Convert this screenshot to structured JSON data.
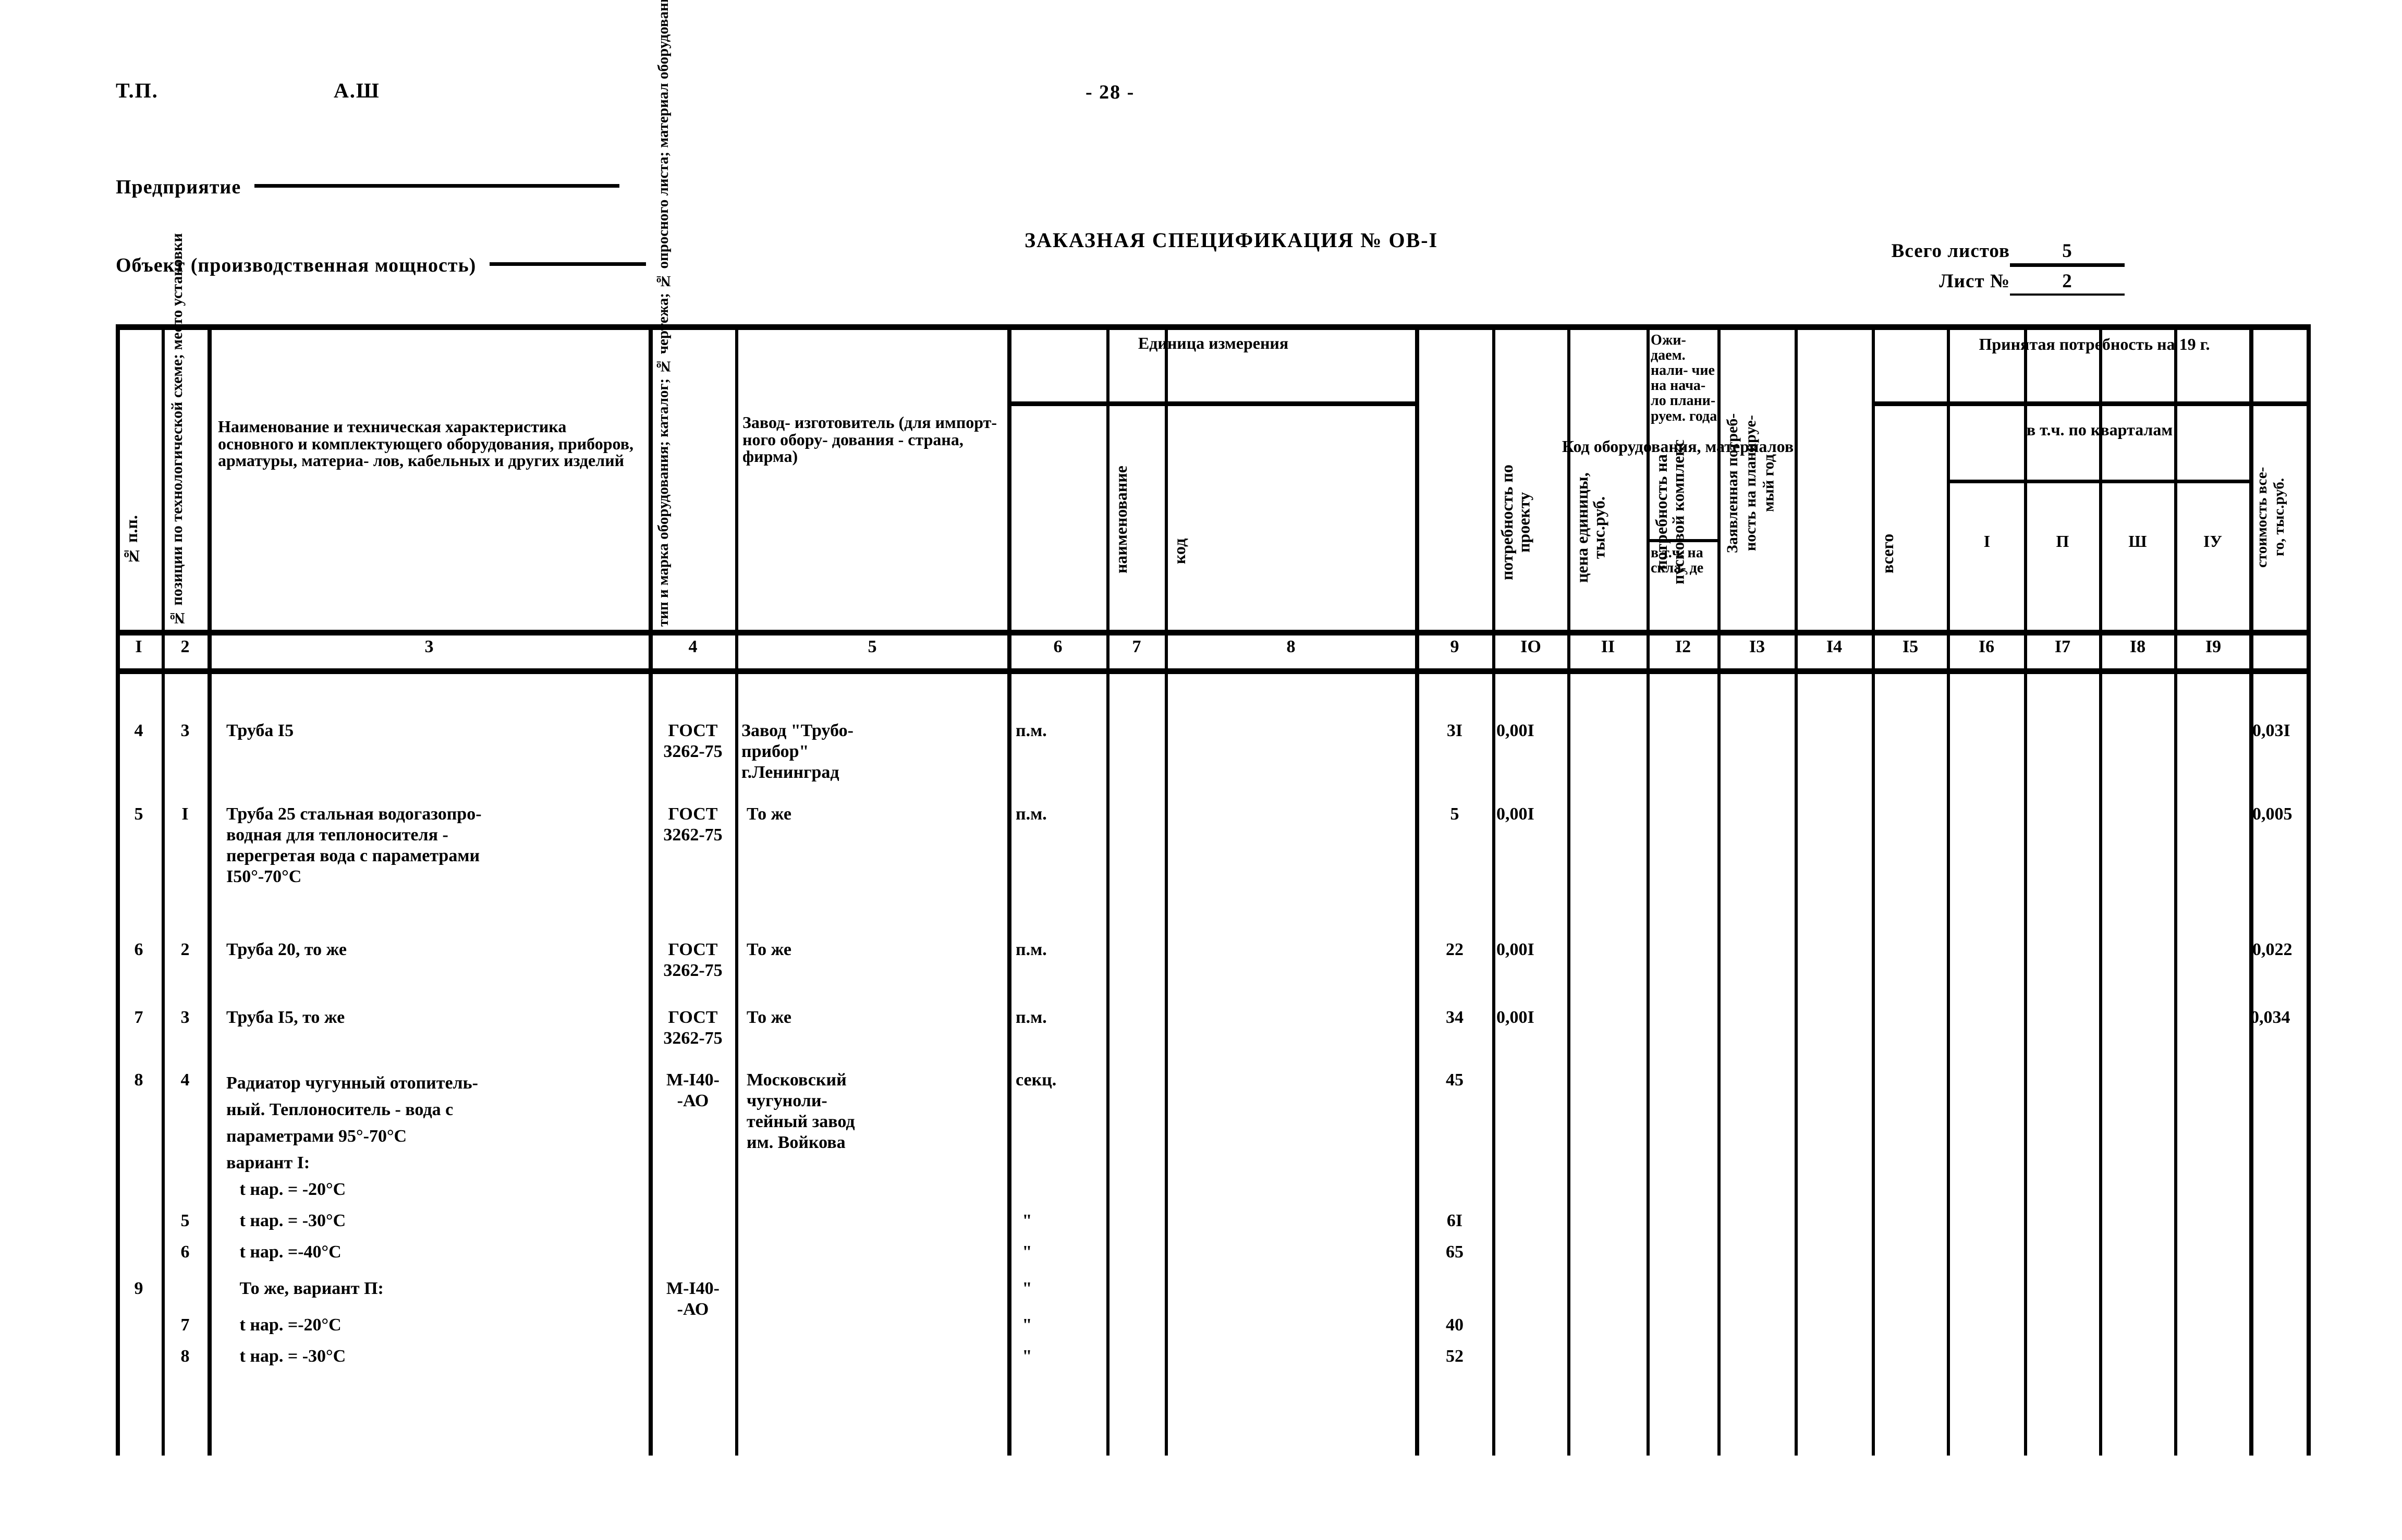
{
  "header": {
    "doc_code": "Т.П.",
    "doc_section": "А.Ш",
    "page_number": "- 28 -",
    "enterprise_label": "Предприятие",
    "object_label": "Объект (производственная мощность)",
    "spec_title": "ЗАКАЗНАЯ СПЕЦИФИКАЦИЯ № ОВ-I",
    "sheets_total_label": "Всего листов",
    "sheets_total_value": "5",
    "sheet_no_label": "Лист №",
    "sheet_no_value": "2"
  },
  "table": {
    "columns": [
      {
        "n": "I",
        "title": "№ п.п."
      },
      {
        "n": "2",
        "title": "№ позиции по технологической схеме; место установки"
      },
      {
        "n": "3",
        "title": "Наименование и техническая\nхарактеристика основного\nи комплектующего оборудования,\nприборов, арматуры, материа-\nлов, кабельных и других\nизделий"
      },
      {
        "n": "4",
        "title": "тип и марка оборудования; каталог; № чертежа; № опросного листа; материал оборудования"
      },
      {
        "n": "5",
        "title": "Завод-\nизготовитель\n(для импорт-\nного обору-\nдования -\nстрана,\nфирма)"
      },
      {
        "n": "6",
        "title": "наименование",
        "group": "Единица\nизмерения"
      },
      {
        "n": "7",
        "title": "код",
        "group": "Единица\nизмерения"
      },
      {
        "n": "8",
        "title": "Код\n\nоборудования,\n\nматериалов"
      },
      {
        "n": "9",
        "title": "потребность по\nпроекту"
      },
      {
        "n": "IO",
        "title": "цена единицы,\nтыс.руб."
      },
      {
        "n": "II",
        "title": "потребность на\nпусковой комплекс"
      },
      {
        "n": "I2",
        "title": "Ожи-\nдаем.\nнали-\nчие\nна\nнача-\nло\nплани-\nруем.\nгода",
        "sub": "в т.ч.\nна\nскла-\nде"
      },
      {
        "n": "I3",
        "title": "Заявленная потреб-\nность на планируе-\nмый год"
      },
      {
        "n": "I4",
        "title": "всего",
        "group": "Принятая потребность на\n19       г."
      },
      {
        "n": "I5",
        "title": "I",
        "group": "Принятая потребность на\n19       г.",
        "sub": "в т.ч. по кварталам"
      },
      {
        "n": "I6",
        "title": "П",
        "group": "Принятая потребность на\n19       г.",
        "sub": "в т.ч. по кварталам"
      },
      {
        "n": "I7",
        "title": "Ш",
        "group": "Принятая потребность на\n19       г.",
        "sub": "в т.ч. по кварталам"
      },
      {
        "n": "I8",
        "title": "IУ",
        "group": "Принятая потребность на\n19       г.",
        "sub": "в т.ч. по кварталам"
      },
      {
        "n": "I9",
        "title": "стоимость все-\nго, тыс.руб."
      }
    ],
    "group_headers": {
      "unit_of_measure": "Единица\nизмерения",
      "accepted_demand": "Принятая потребность на\n19       г.",
      "by_quarters": "в т.ч. по кварталам",
      "expected_sub": "в т.ч.\nна\nскла-\nде"
    },
    "rows": [
      {
        "no": "4",
        "pos": "3",
        "name": "Труба I5",
        "type": "ГОСТ\n3262-75",
        "manufacturer": "Завод \"Трубо-\nприбор\"\nг.Ленинград",
        "unit": "п.м.",
        "demand": "3I",
        "unit_price": "0,00I",
        "total_cost": "0,03I"
      },
      {
        "no": "5",
        "pos": "I",
        "name": "Труба 25 стальная водогазопро-\nводная для теплоносителя -\nперегретая вода с параметрами\nI50°-70°С",
        "type": "ГОСТ\n3262-75",
        "manufacturer": "То же",
        "unit": "п.м.",
        "demand": "5",
        "unit_price": "0,00I",
        "total_cost": "0,005"
      },
      {
        "no": "6",
        "pos": "2",
        "name": "Труба 20, то же",
        "type": "ГОСТ\n3262-75",
        "manufacturer": "То же",
        "unit": "п.м.",
        "demand": "22",
        "unit_price": "0,00I",
        "total_cost": "0,022"
      },
      {
        "no": "7",
        "pos": "3",
        "name": "Труба I5, то же",
        "type": "ГОСТ\n3262-75",
        "manufacturer": "То же",
        "unit": "п.м.",
        "demand": "34",
        "unit_price": "0,00I",
        "total_cost": "0,034"
      },
      {
        "no": "8",
        "pos": "4",
        "name": "Радиатор чугунный отопитель-\nный. Теплоноситель - вода с\nпараметрами 95°-70°С\nвариант I:\n   t нар. = -20°С",
        "type": "М-I40-\n-АО",
        "manufacturer": "Московский\nчугуноли-\nтейный завод\nим. Войкова",
        "unit": "секц.",
        "demand": "45",
        "unit_price": "",
        "total_cost": ""
      },
      {
        "no": "",
        "pos": "5",
        "name": "   t нар. = -30°С",
        "type": "",
        "manufacturer": "",
        "unit": "\"",
        "demand": "6I",
        "unit_price": "",
        "total_cost": ""
      },
      {
        "no": "",
        "pos": "6",
        "name": "   t нар. =-40°С",
        "type": "",
        "manufacturer": "",
        "unit": "\"",
        "demand": "65",
        "unit_price": "",
        "total_cost": ""
      },
      {
        "no": "9",
        "pos": "",
        "name": "   То же, вариант П:",
        "type": "М-I40-\n-АО",
        "manufacturer": "",
        "unit": "\"",
        "demand": "",
        "unit_price": "",
        "total_cost": ""
      },
      {
        "no": "",
        "pos": "7",
        "name": "   t нар. =-20°С",
        "type": "",
        "manufacturer": "",
        "unit": "\"",
        "demand": "40",
        "unit_price": "",
        "total_cost": ""
      },
      {
        "no": "",
        "pos": "8",
        "name": "   t нар. = -30°С",
        "type": "",
        "manufacturer": "",
        "unit": "\"",
        "demand": "52",
        "unit_price": "",
        "total_cost": ""
      }
    ]
  }
}
